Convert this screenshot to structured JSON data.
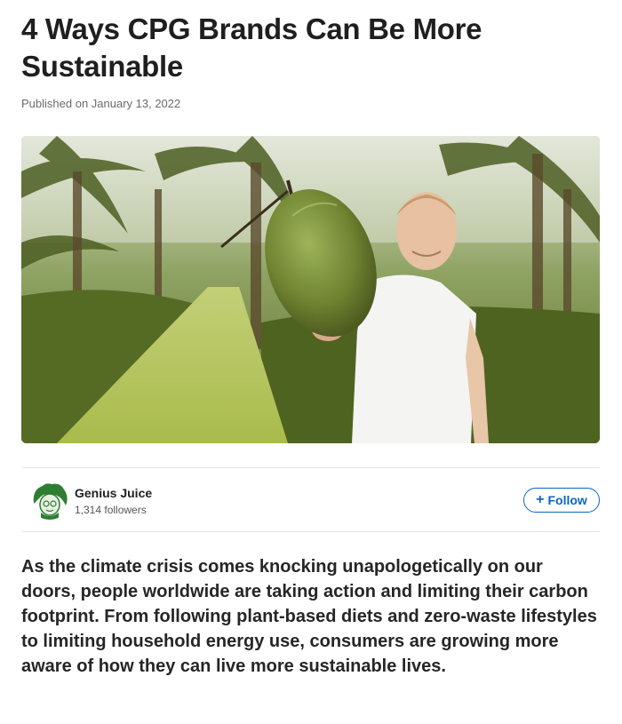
{
  "article": {
    "title": "4 Ways CPG Brands Can Be More Sustainable",
    "published": "Published on January 13, 2022",
    "body": "As the climate crisis comes knocking unapologetically on our doors, people worldwide are taking action and limiting their carbon footprint. From following plant-based diets and zero-waste lifestyles to limiting household energy use, consumers are growing more aware of how they can live more sustainable lives."
  },
  "author": {
    "name": "Genius Juice",
    "followers": "1,314 followers",
    "follow_label": "Follow"
  },
  "colors": {
    "accent": "#0a66c2"
  },
  "icons": {
    "follow": "plus-icon"
  }
}
